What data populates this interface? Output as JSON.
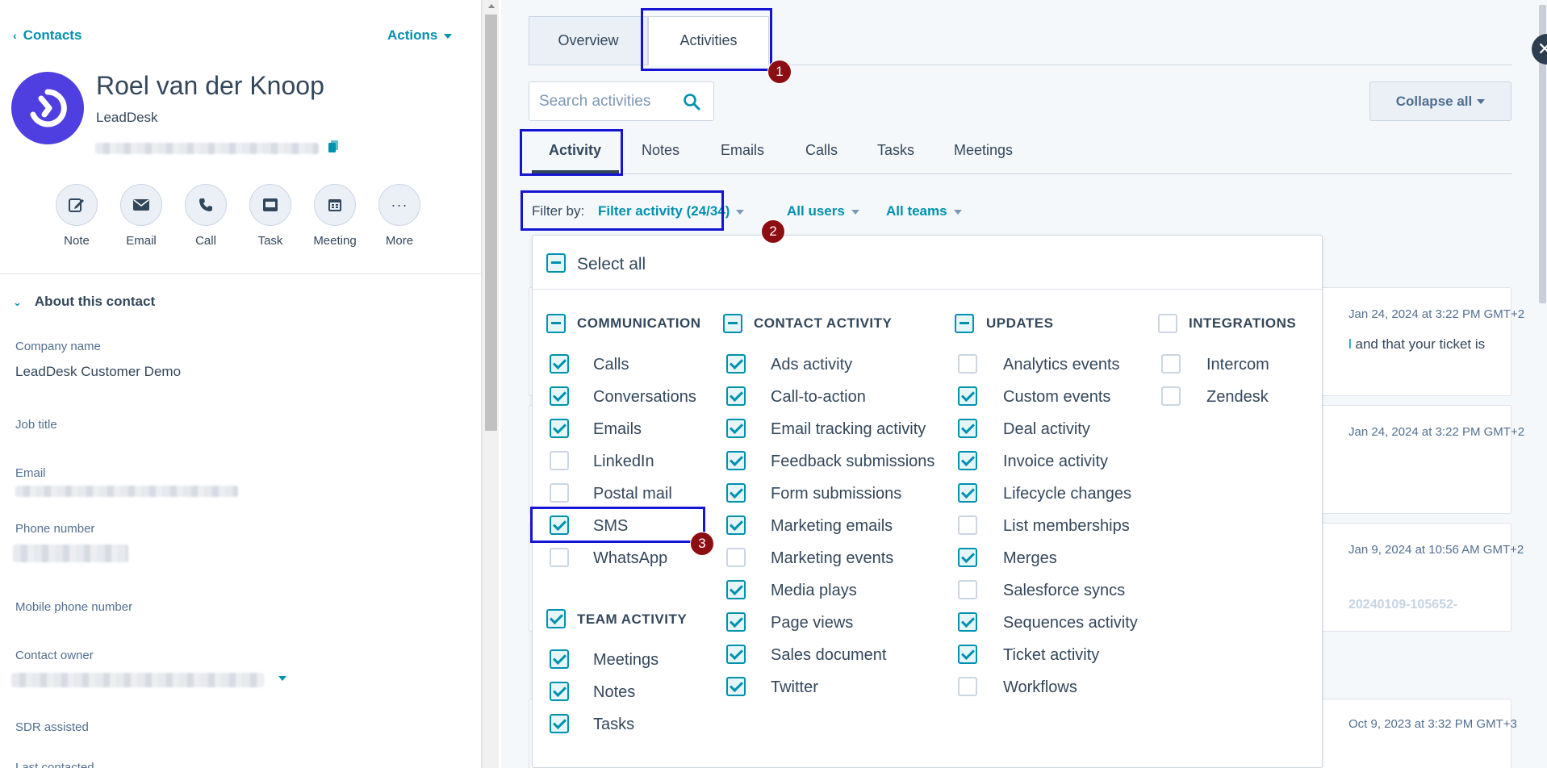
{
  "left": {
    "back_label": "Contacts",
    "actions_label": "Actions",
    "contact_name": "Roel van der Knoop",
    "company": "LeadDesk",
    "quick_actions": [
      "Note",
      "Email",
      "Call",
      "Task",
      "Meeting",
      "More"
    ],
    "about_title": "About this contact",
    "properties": [
      {
        "label": "Company name",
        "value": "LeadDesk Customer Demo"
      },
      {
        "label": "Job title",
        "value": ""
      },
      {
        "label": "Email",
        "value": ""
      },
      {
        "label": "Phone number",
        "value": ""
      },
      {
        "label": "Mobile phone number",
        "value": ""
      },
      {
        "label": "Contact owner",
        "value": ""
      },
      {
        "label": "SDR assisted",
        "value": ""
      },
      {
        "label": "Last contacted",
        "value": ""
      }
    ]
  },
  "right": {
    "main_tabs": [
      "Overview",
      "Activities"
    ],
    "active_main_tab": "Activities",
    "search_placeholder": "Search activities",
    "collapse_label": "Collapse all",
    "sub_tabs": [
      "Activity",
      "Notes",
      "Emails",
      "Calls",
      "Tasks",
      "Meetings"
    ],
    "active_sub_tab": "Activity",
    "filter_by_label": "Filter by:",
    "filter_activity": "Filter activity (24/34)",
    "all_users": "All users",
    "all_teams": "All teams",
    "feed": [
      {
        "date": "Jan 24, 2024 at 3:22 PM GMT+2",
        "text": "l and that your ticket is"
      },
      {
        "date": "Jan 24, 2024 at 3:22 PM GMT+2",
        "text": ""
      },
      {
        "date": "Jan 9, 2024 at 10:56 AM GMT+2",
        "text": "20240109-105652-"
      },
      {
        "date": "Oct 9, 2023 at 3:32 PM GMT+3",
        "text": ""
      }
    ]
  },
  "filter_menu": {
    "select_all": "Select all",
    "categories": [
      {
        "name": "COMMUNICATION",
        "state": "indeterminate",
        "items": [
          {
            "label": "Calls",
            "checked": true
          },
          {
            "label": "Conversations",
            "checked": true
          },
          {
            "label": "Emails",
            "checked": true
          },
          {
            "label": "LinkedIn",
            "checked": false
          },
          {
            "label": "Postal mail",
            "checked": false
          },
          {
            "label": "SMS",
            "checked": true
          },
          {
            "label": "WhatsApp",
            "checked": false
          }
        ]
      },
      {
        "name": "TEAM ACTIVITY",
        "state": "checked",
        "items": [
          {
            "label": "Meetings",
            "checked": true
          },
          {
            "label": "Notes",
            "checked": true
          },
          {
            "label": "Tasks",
            "checked": true
          }
        ]
      },
      {
        "name": "CONTACT ACTIVITY",
        "state": "indeterminate",
        "items": [
          {
            "label": "Ads activity",
            "checked": true
          },
          {
            "label": "Call-to-action",
            "checked": true
          },
          {
            "label": "Email tracking activity",
            "checked": true
          },
          {
            "label": "Feedback submissions",
            "checked": true
          },
          {
            "label": "Form submissions",
            "checked": true
          },
          {
            "label": "Marketing emails",
            "checked": true
          },
          {
            "label": "Marketing events",
            "checked": false
          },
          {
            "label": "Media plays",
            "checked": true
          },
          {
            "label": "Page views",
            "checked": true
          },
          {
            "label": "Sales document",
            "checked": true
          },
          {
            "label": "Twitter",
            "checked": true
          }
        ]
      },
      {
        "name": "UPDATES",
        "state": "indeterminate",
        "items": [
          {
            "label": "Analytics events",
            "checked": false
          },
          {
            "label": "Custom events",
            "checked": true
          },
          {
            "label": "Deal activity",
            "checked": true
          },
          {
            "label": "Invoice activity",
            "checked": true
          },
          {
            "label": "Lifecycle changes",
            "checked": true
          },
          {
            "label": "List memberships",
            "checked": false
          },
          {
            "label": "Merges",
            "checked": true
          },
          {
            "label": "Salesforce syncs",
            "checked": false
          },
          {
            "label": "Sequences activity",
            "checked": true
          },
          {
            "label": "Ticket activity",
            "checked": true
          },
          {
            "label": "Workflows",
            "checked": false
          }
        ]
      },
      {
        "name": "INTEGRATIONS",
        "state": "unchecked",
        "items": [
          {
            "label": "Intercom",
            "checked": false
          },
          {
            "label": "Zendesk",
            "checked": false
          }
        ]
      }
    ]
  },
  "annotations": [
    "1",
    "2",
    "3"
  ],
  "colors": {
    "accent": "#0091ae",
    "highlight": "#1414d2",
    "badge": "#8c0d12",
    "avatar": "#4f3fe0"
  }
}
